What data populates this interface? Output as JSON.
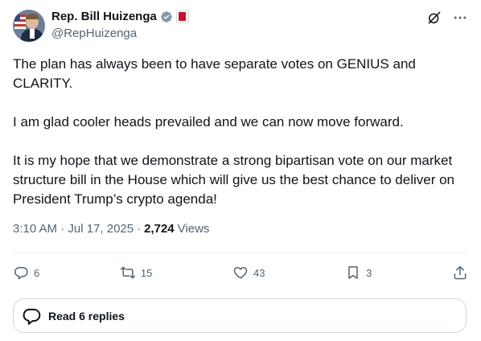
{
  "author": {
    "name": "Rep. Bill Huizenga",
    "handle": "@RepHuizenga"
  },
  "icons": {
    "avatar": "profile-photo",
    "verified": "verified-badge-icon",
    "affiliation": "house-affiliation-icon",
    "grok": "grok-icon",
    "more": "more-icon"
  },
  "colors": {
    "text": "#0f1419",
    "secondary": "#536471",
    "verified_badge": "#829aab",
    "affiliation": "#c8102e",
    "border": "#cfd9de"
  },
  "post": {
    "paragraphs": [
      "The plan has always been to have separate votes on GENIUS and CLARITY.",
      "I am glad cooler heads prevailed and we can now move forward.",
      "It is my hope that we demonstrate a strong bipartisan vote on our market structure bill in the House which will give us the best chance to deliver on President Trump’s crypto agenda!"
    ],
    "timestamp": "3:10 AM · Jul 17, 2025",
    "separator": "·",
    "views_count": "2,724",
    "views_label": "Views"
  },
  "actions": {
    "replies": "6",
    "reposts": "15",
    "likes": "43",
    "bookmarks": "3"
  },
  "read_replies_label": "Read 6 replies"
}
